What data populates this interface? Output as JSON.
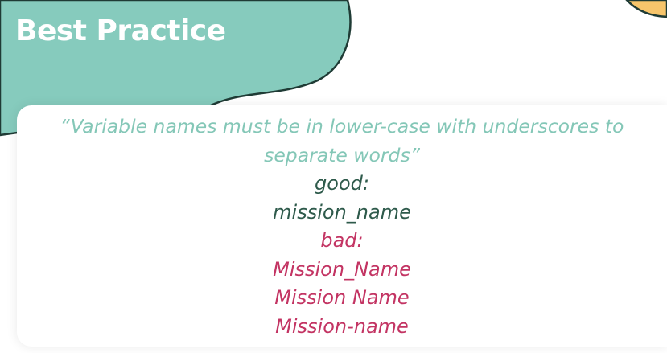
{
  "slide": {
    "title": "Best Practice",
    "quote_line1": "“Variable names must be in lower-case with underscores to",
    "quote_line2": "separate words”",
    "good_label": "good:",
    "good_examples": [
      "mission_name"
    ],
    "bad_label": "bad:",
    "bad_examples": [
      "Mission_Name",
      "Mission Name",
      "Mission-name"
    ]
  },
  "colors": {
    "teal_blob": "#86cbbd",
    "orange_blob": "#f7c56b",
    "blob_outline": "#1f3b35",
    "quote": "#84c7b7",
    "good": "#2e5a4b",
    "bad": "#c33463"
  }
}
